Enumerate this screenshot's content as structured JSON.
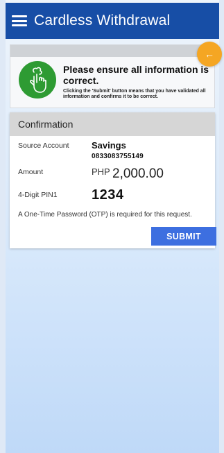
{
  "header": {
    "title": "Cardless Withdrawal"
  },
  "notice": {
    "heading": "Please ensure all information is correct.",
    "subtext": "Clicking the 'Submit' button means that you have validated all information and confirms it to be correct."
  },
  "back_button": {
    "label": "←"
  },
  "confirmation": {
    "title": "Confirmation",
    "source_account_label": "Source Account",
    "account_type": "Savings",
    "account_number": "0833083755149",
    "amount_label": "Amount",
    "currency": "PHP",
    "amount": "2,000.00",
    "pin_label": "4-Digit PIN1",
    "pin": "1234",
    "otp_note": "A One-Time Password (OTP) is required for this request.",
    "submit_label": "SUBMIT"
  },
  "colors": {
    "topbar": "#174ea6",
    "accent_orange": "#f5a623",
    "icon_green": "#2e9b33",
    "submit_blue": "#3d6fe0"
  }
}
